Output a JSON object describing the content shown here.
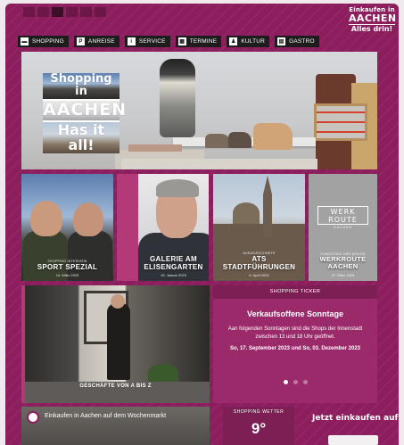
{
  "brand": {
    "line1": "Einkaufen in",
    "line2": "AACHEN",
    "line3": "Alles drin!"
  },
  "nav": [
    {
      "label": "SHOPPING",
      "icon": "shopping-icon",
      "glyph": "▬"
    },
    {
      "label": "ANREISE",
      "icon": "parking-icon",
      "glyph": "P"
    },
    {
      "label": "SERVICE",
      "icon": "info-icon",
      "glyph": "i"
    },
    {
      "label": "TERMINE",
      "icon": "calendar-icon",
      "glyph": "▦"
    },
    {
      "label": "KULTUR",
      "icon": "culture-icon",
      "glyph": "♟"
    },
    {
      "label": "GASTRO",
      "icon": "gastro-icon",
      "glyph": "▤"
    }
  ],
  "hero": {
    "line1": "Shopping in",
    "line2": "AACHEN",
    "line3": "Has it all!"
  },
  "tiles": [
    {
      "sup": "SHOPPING INTERVIEW",
      "title": "SPORT SPEZIAL",
      "date": "14. März 2023"
    },
    {
      "sup": "",
      "title": "GALERIE AM\nELISENGARTEN",
      "date": "19. Januar 2023"
    },
    {
      "sup": "AUSGEZEICHNETE",
      "title": "ATS\nSTADTFÜHRUNGEN",
      "date": "6. April 2023"
    },
    {
      "sup": "FUNDSTÜCK DER WOCHE",
      "title": "WERKROUTE AACHEN",
      "date": "27. März 2023",
      "logo_a": "WERK",
      "logo_b": "ROUTE",
      "logo_c": "AACHEN"
    }
  ],
  "shops": {
    "caption": "GESCHÄFTE VON A BIS Z"
  },
  "ticker": {
    "header": "SHOPPING TICKER",
    "title": "Verkaufsoffene Sonntage",
    "body": "Aan folgenden Sonntagen sind die Shops der Innenstadt zwischen 13 und 18 Uhr geöffnet.",
    "dates": "So, 17. September 2023 und So, 03. Dezember 2023"
  },
  "video": {
    "title": "Einkaufen in Aachen auf dem Wochenmarkt"
  },
  "weather": {
    "header": "SHOPPING WETTER",
    "temp": "9°"
  },
  "cta": {
    "label": "Jetzt einkaufen auf"
  },
  "colors": {
    "background": "#8c1e5e",
    "ticker": "#9b2a6b",
    "nav": "#1d1d1d"
  }
}
